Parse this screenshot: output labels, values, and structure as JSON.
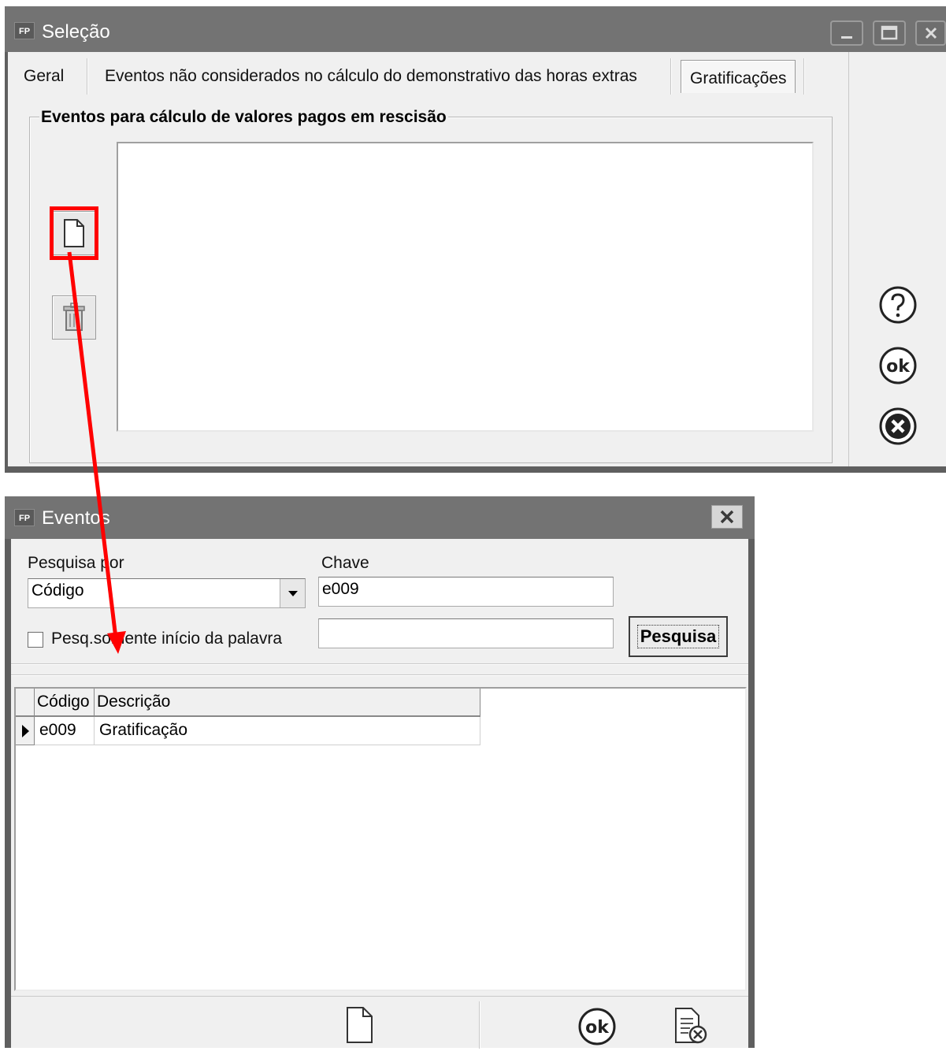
{
  "selecao": {
    "logo": "FP",
    "title": "Seleção",
    "tabs": [
      {
        "label": "Geral"
      },
      {
        "label": "Eventos não considerados no cálculo do demonstrativo das horas extras"
      },
      {
        "label": "Gratificações"
      }
    ],
    "active_tab": "Gratificações",
    "group_title": "Eventos para cálculo de valores pagos em rescisão",
    "icons": {
      "new": "new-document-icon",
      "delete": "trash-icon",
      "help": "help-icon",
      "ok": "ok-icon",
      "cancel": "cancel-icon"
    }
  },
  "eventos": {
    "logo": "FP",
    "title": "Eventos",
    "search_by_label": "Pesquisa por",
    "search_by_value": "Código",
    "key_label": "Chave",
    "key_value": "e009",
    "second_key_value": "",
    "prefix_only_label": "Pesq.somente início da palavra",
    "prefix_only_checked": false,
    "search_button": "Pesquisa",
    "grid": {
      "columns": [
        "Código",
        "Descrição"
      ],
      "rows": [
        {
          "code": "e009",
          "description": "Gratificação",
          "selected": true
        }
      ]
    }
  },
  "annotation": {
    "color": "#ff0000"
  }
}
